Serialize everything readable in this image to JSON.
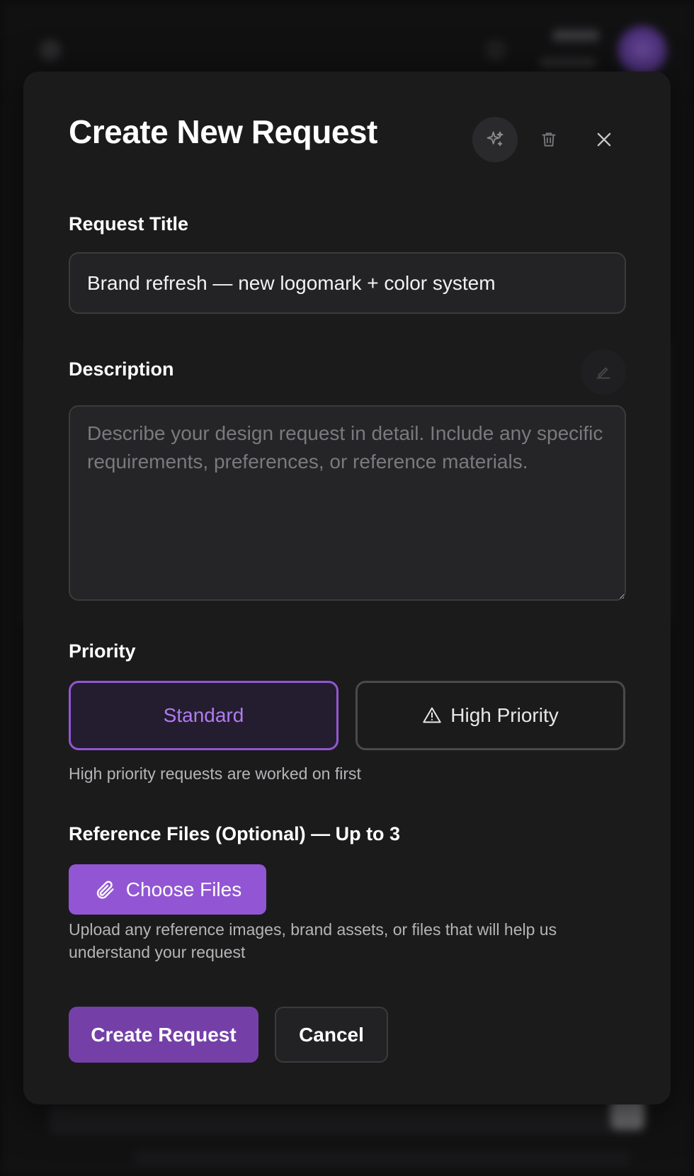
{
  "modal": {
    "title": "Create New Request",
    "header_icons": [
      "sparkles-icon",
      "trash-icon",
      "close-icon"
    ]
  },
  "form": {
    "title_label": "Request Title",
    "title_value": "Brand refresh — new logomark + color system",
    "description_label": "Description",
    "description_placeholder": "Describe your design request in detail. Include any specific requirements, preferences, or reference materials.",
    "priority_label": "Priority",
    "priority_standard": "Standard",
    "priority_high": "High Priority",
    "priority_selected": "Standard",
    "priority_helper": "High priority requests are worked on first",
    "files_label": "Reference Files (Optional) — Up to 3",
    "choose_files": "Choose Files",
    "files_helper": "Upload any reference images, brand assets, or files that will help us understand your request"
  },
  "actions": {
    "create": "Create Request",
    "cancel": "Cancel"
  },
  "colors": {
    "accent": "#9256d4",
    "primary_button": "#7440a8",
    "modal_bg": "#1b1b1c"
  }
}
